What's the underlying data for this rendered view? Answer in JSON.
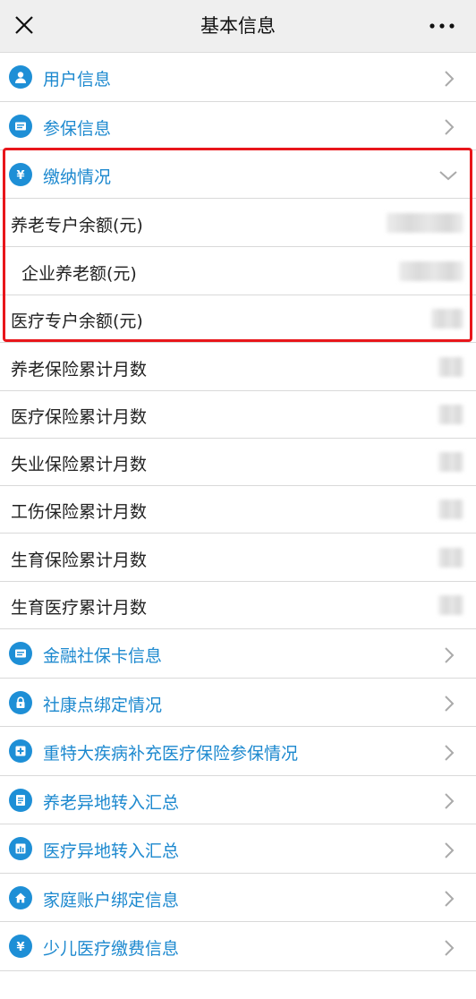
{
  "header": {
    "title": "基本信息"
  },
  "menu_top": [
    {
      "label": "用户信息",
      "icon": "user-icon"
    },
    {
      "label": "参保信息",
      "icon": "card-icon"
    }
  ],
  "payment": {
    "label": "缴纳情况",
    "icon": "yuan-icon",
    "items": [
      {
        "label": "养老专户余额(元)"
      },
      {
        "label": "企业养老额(元)"
      },
      {
        "label": "医疗专户余额(元)"
      }
    ]
  },
  "stats": [
    {
      "label": "养老保险累计月数"
    },
    {
      "label": "医疗保险累计月数"
    },
    {
      "label": "失业保险累计月数"
    },
    {
      "label": "工伤保险累计月数"
    },
    {
      "label": "生育保险累计月数"
    },
    {
      "label": "生育医疗累计月数"
    }
  ],
  "menu_bottom": [
    {
      "label": "金融社保卡信息",
      "icon": "card-icon"
    },
    {
      "label": "社康点绑定情况",
      "icon": "lock-icon"
    },
    {
      "label": "重特大疾病补充医疗保险参保情况",
      "icon": "medical-cross-icon"
    },
    {
      "label": "养老异地转入汇总",
      "icon": "document-icon"
    },
    {
      "label": "医疗异地转入汇总",
      "icon": "bar-chart-icon"
    },
    {
      "label": "家庭账户绑定信息",
      "icon": "home-icon"
    },
    {
      "label": "少儿医疗缴费信息",
      "icon": "yuan-icon"
    }
  ],
  "colors": {
    "accent": "#1d89cf",
    "highlight": "#e8161b"
  }
}
